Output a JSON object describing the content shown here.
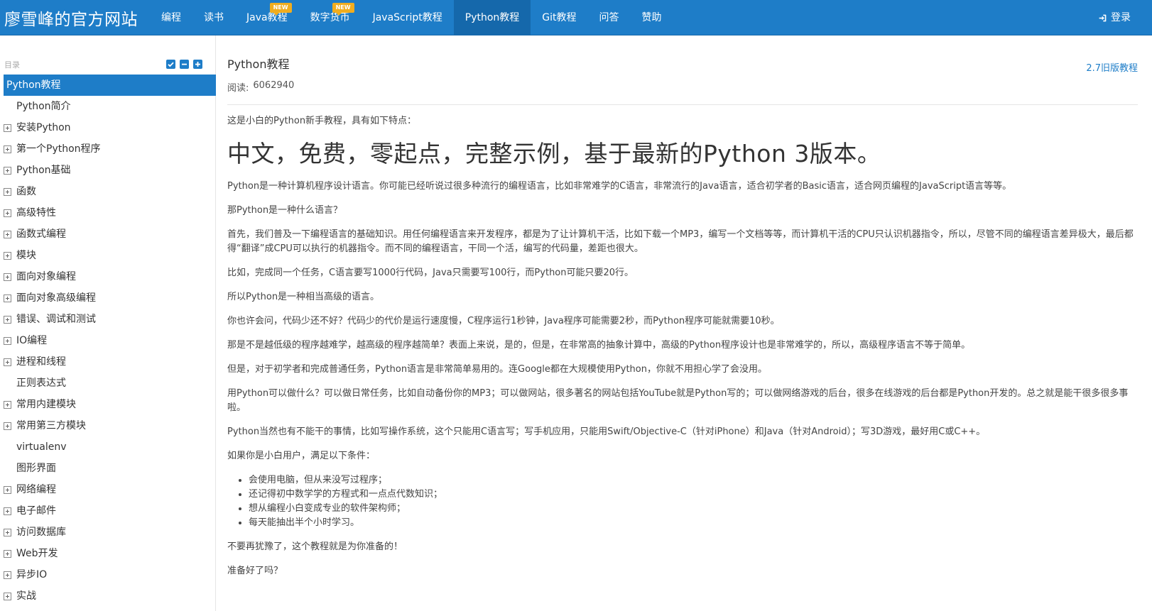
{
  "navbar": {
    "brand": "廖雪峰的官方网站",
    "items": [
      {
        "label": "编程",
        "badge": ""
      },
      {
        "label": "读书",
        "badge": ""
      },
      {
        "label": "Java教程",
        "badge": "NEW"
      },
      {
        "label": "数字货币",
        "badge": "NEW"
      },
      {
        "label": "JavaScript教程",
        "badge": ""
      },
      {
        "label": "Python教程",
        "badge": ""
      },
      {
        "label": "Git教程",
        "badge": ""
      },
      {
        "label": "问答",
        "badge": ""
      },
      {
        "label": "赞助",
        "badge": ""
      }
    ],
    "active": "Python教程",
    "login": "登录",
    "login_icon": "sign-in-icon"
  },
  "sidebar": {
    "title": "目录",
    "actions": [
      "check-square-icon",
      "minus-square-icon",
      "plus-square-icon"
    ],
    "items": [
      {
        "label": "Python教程",
        "expandable": false,
        "active": true
      },
      {
        "label": "Python简介",
        "expandable": false
      },
      {
        "label": "安装Python",
        "expandable": true
      },
      {
        "label": "第一个Python程序",
        "expandable": true
      },
      {
        "label": "Python基础",
        "expandable": true
      },
      {
        "label": "函数",
        "expandable": true
      },
      {
        "label": "高级特性",
        "expandable": true
      },
      {
        "label": "函数式编程",
        "expandable": true
      },
      {
        "label": "模块",
        "expandable": true
      },
      {
        "label": "面向对象编程",
        "expandable": true
      },
      {
        "label": "面向对象高级编程",
        "expandable": true
      },
      {
        "label": "错误、调试和测试",
        "expandable": true
      },
      {
        "label": "IO编程",
        "expandable": true
      },
      {
        "label": "进程和线程",
        "expandable": true
      },
      {
        "label": "正则表达式",
        "expandable": false
      },
      {
        "label": "常用内建模块",
        "expandable": true
      },
      {
        "label": "常用第三方模块",
        "expandable": true
      },
      {
        "label": "virtualenv",
        "expandable": false
      },
      {
        "label": "图形界面",
        "expandable": false
      },
      {
        "label": "网络编程",
        "expandable": true
      },
      {
        "label": "电子邮件",
        "expandable": true
      },
      {
        "label": "访问数据库",
        "expandable": true
      },
      {
        "label": "Web开发",
        "expandable": true
      },
      {
        "label": "异步IO",
        "expandable": true
      },
      {
        "label": "实战",
        "expandable": true
      }
    ]
  },
  "main": {
    "title": "Python教程",
    "old_version_link": "2.7旧版教程",
    "reads_label": "阅读:",
    "reads_count": "6062940",
    "intro": "这是小白的Python新手教程，具有如下特点：",
    "headline": "中文，免费，零起点，完整示例，基于最新的Python 3版本。",
    "paragraphs": [
      "Python是一种计算机程序设计语言。你可能已经听说过很多种流行的编程语言，比如非常难学的C语言，非常流行的Java语言，适合初学者的Basic语言，适合网页编程的JavaScript语言等等。",
      "那Python是一种什么语言？",
      "首先，我们普及一下编程语言的基础知识。用任何编程语言来开发程序，都是为了让计算机干活，比如下载一个MP3，编写一个文档等等，而计算机干活的CPU只认识机器指令，所以，尽管不同的编程语言差异极大，最后都得“翻译”成CPU可以执行的机器指令。而不同的编程语言，干同一个活，编写的代码量，差距也很大。",
      "比如，完成同一个任务，C语言要写1000行代码，Java只需要写100行，而Python可能只要20行。",
      "所以Python是一种相当高级的语言。",
      "你也许会问，代码少还不好？代码少的代价是运行速度慢，C程序运行1秒钟，Java程序可能需要2秒，而Python程序可能就需要10秒。",
      "那是不是越低级的程序越难学，越高级的程序越简单？表面上来说，是的，但是，在非常高的抽象计算中，高级的Python程序设计也是非常难学的，所以，高级程序语言不等于简单。",
      "但是，对于初学者和完成普通任务，Python语言是非常简单易用的。连Google都在大规模使用Python，你就不用担心学了会没用。",
      "用Python可以做什么？可以做日常任务，比如自动备份你的MP3；可以做网站，很多著名的网站包括YouTube就是Python写的；可以做网络游戏的后台，很多在线游戏的后台都是Python开发的。总之就是能干很多很多事啦。",
      "Python当然也有不能干的事情，比如写操作系统，这个只能用C语言写；写手机应用，只能用Swift/Objective-C（针对iPhone）和Java（针对Android）；写3D游戏，最好用C或C++。",
      "如果你是小白用户，满足以下条件："
    ],
    "conditions": [
      "会使用电脑，但从来没写过程序；",
      "还记得初中数学学的方程式和一点点代数知识；",
      "想从编程小白变成专业的软件架构师；",
      "每天能抽出半个小时学习。"
    ],
    "closing": [
      "不要再犹豫了，这个教程就是为你准备的！",
      "准备好了吗？"
    ]
  },
  "colors": {
    "accent": "#1e7dc8",
    "badge": "#f0ad1f"
  }
}
